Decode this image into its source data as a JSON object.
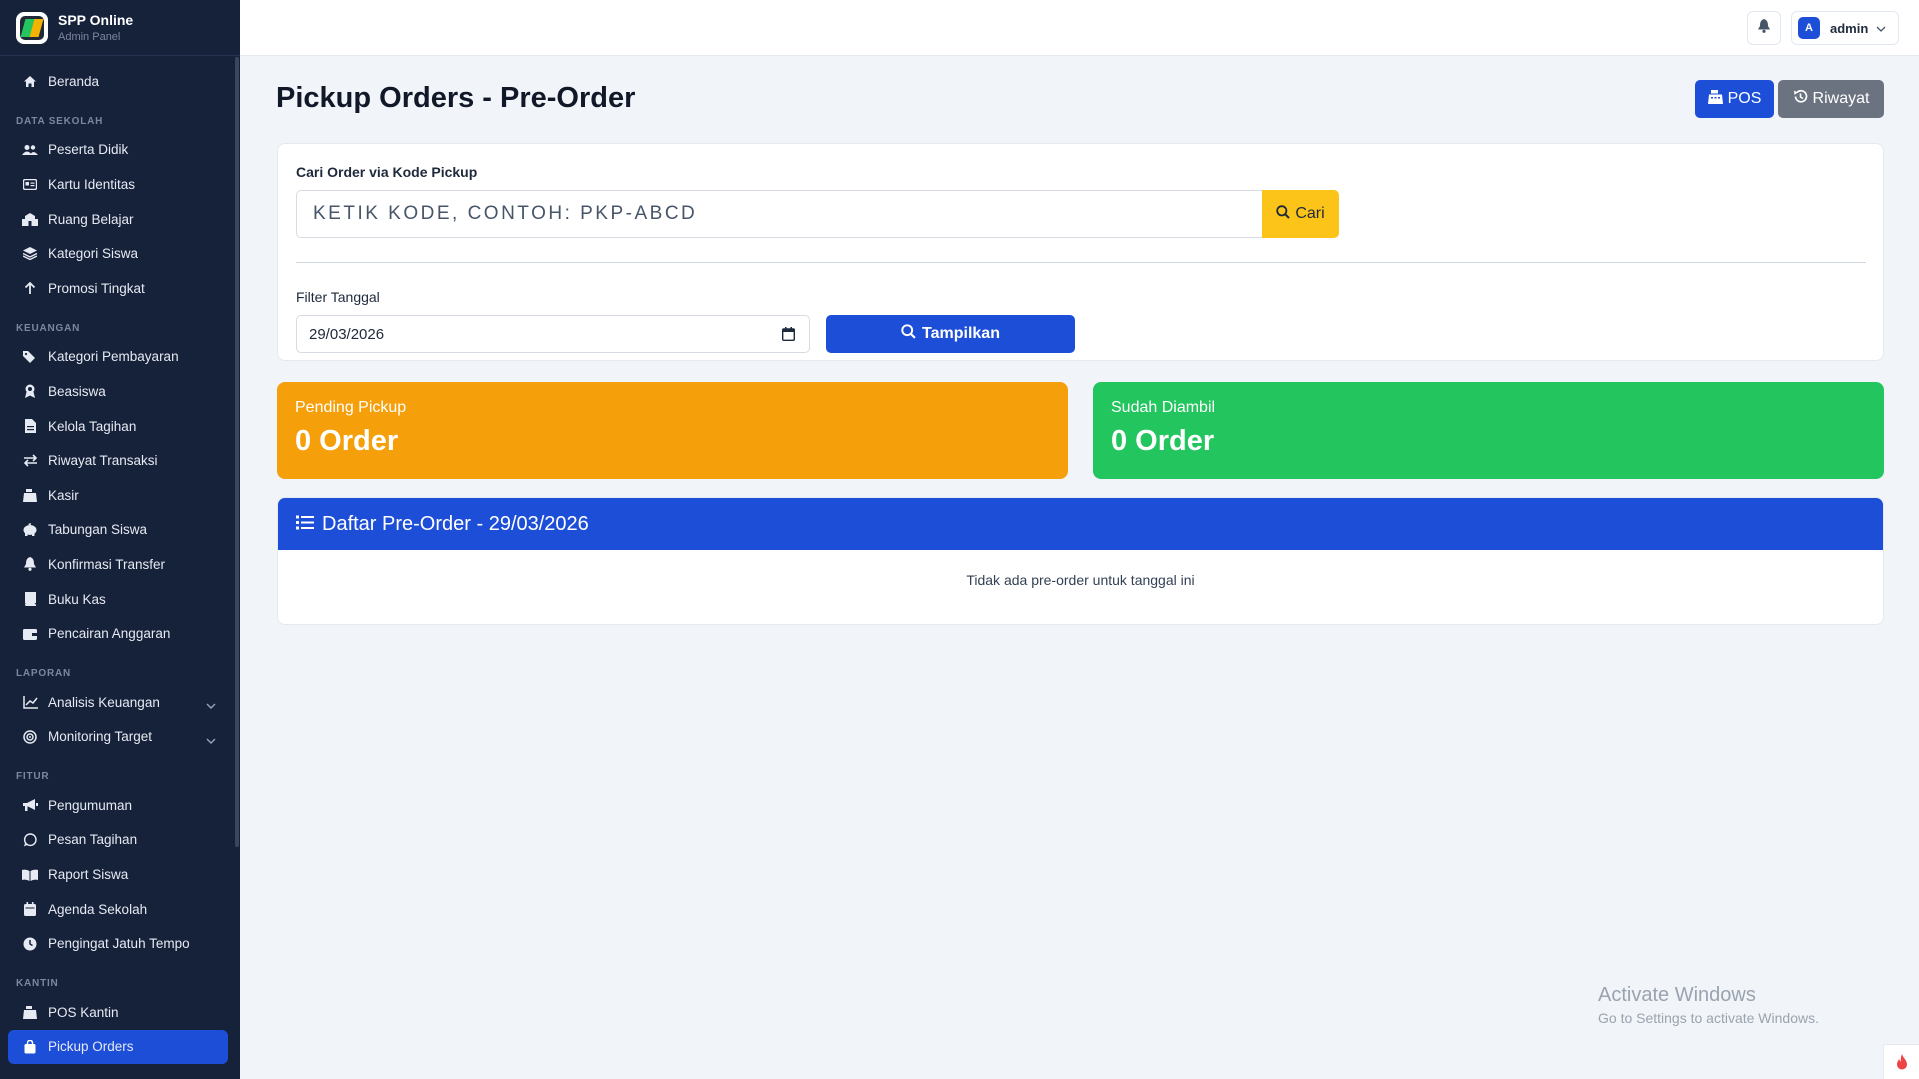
{
  "brand": {
    "title": "SPP Online",
    "subtitle": "Admin Panel"
  },
  "sidebar": {
    "home": {
      "label": "Beranda",
      "icon": "home-icon"
    },
    "sections": [
      {
        "title": "DATA SEKOLAH",
        "items": [
          {
            "label": "Peserta Didik",
            "icon": "users-icon"
          },
          {
            "label": "Kartu Identitas",
            "icon": "id-card-icon"
          },
          {
            "label": "Ruang Belajar",
            "icon": "school-icon"
          },
          {
            "label": "Kategori Siswa",
            "icon": "layers-icon"
          },
          {
            "label": "Promosi Tingkat",
            "icon": "arrow-up-icon"
          }
        ]
      },
      {
        "title": "KEUANGAN",
        "items": [
          {
            "label": "Kategori Pembayaran",
            "icon": "tags-icon"
          },
          {
            "label": "Beasiswa",
            "icon": "award-icon"
          },
          {
            "label": "Kelola Tagihan",
            "icon": "invoice-icon"
          },
          {
            "label": "Riwayat Transaksi",
            "icon": "exchange-icon"
          },
          {
            "label": "Kasir",
            "icon": "cash-register-icon"
          },
          {
            "label": "Tabungan Siswa",
            "icon": "piggy-bank-icon"
          },
          {
            "label": "Konfirmasi Transfer",
            "icon": "bell-icon"
          },
          {
            "label": "Buku Kas",
            "icon": "book-icon"
          },
          {
            "label": "Pencairan Anggaran",
            "icon": "wallet-icon"
          }
        ]
      },
      {
        "title": "LAPORAN",
        "items": [
          {
            "label": "Analisis Keuangan",
            "icon": "chart-line-icon",
            "expandable": true
          },
          {
            "label": "Monitoring Target",
            "icon": "target-icon",
            "expandable": true
          }
        ]
      },
      {
        "title": "FITUR",
        "items": [
          {
            "label": "Pengumuman",
            "icon": "bullhorn-icon"
          },
          {
            "label": "Pesan Tagihan",
            "icon": "whatsapp-icon"
          },
          {
            "label": "Raport Siswa",
            "icon": "book-open-icon"
          },
          {
            "label": "Agenda Sekolah",
            "icon": "calendar-icon"
          },
          {
            "label": "Pengingat Jatuh Tempo",
            "icon": "clock-icon"
          }
        ]
      },
      {
        "title": "KANTIN",
        "items": [
          {
            "label": "POS Kantin",
            "icon": "cash-register-icon"
          },
          {
            "label": "Pickup Orders",
            "icon": "shopping-bag-icon",
            "active": true
          }
        ]
      }
    ]
  },
  "topbar": {
    "user_initial": "A",
    "user_name": "admin"
  },
  "page": {
    "title": "Pickup Orders - Pre-Order",
    "pos_button": "POS",
    "riwayat_button": "Riwayat"
  },
  "search": {
    "label": "Cari Order via Kode Pickup",
    "placeholder": "KETIK KODE, CONTOH: PKP-ABCD",
    "button": "Cari"
  },
  "filter": {
    "label": "Filter Tanggal",
    "date_value": "29/03/2026",
    "button": "Tampilkan"
  },
  "stats": {
    "pending_label": "Pending Pickup",
    "pending_value": "0 Order",
    "done_label": "Sudah Diambil",
    "done_value": "0 Order"
  },
  "list": {
    "title": "Daftar Pre-Order - 29/03/2026",
    "empty_text": "Tidak ada pre-order untuk tanggal ini"
  },
  "watermark": {
    "title": "Activate Windows",
    "subtitle": "Go to Settings to activate Windows."
  },
  "colors": {
    "sidebar_bg": "#16213a",
    "primary": "#1d4ed8",
    "warning": "#f59f0a",
    "success": "#22c55e",
    "search_button": "#fcc419",
    "secondary": "#6b7280"
  }
}
